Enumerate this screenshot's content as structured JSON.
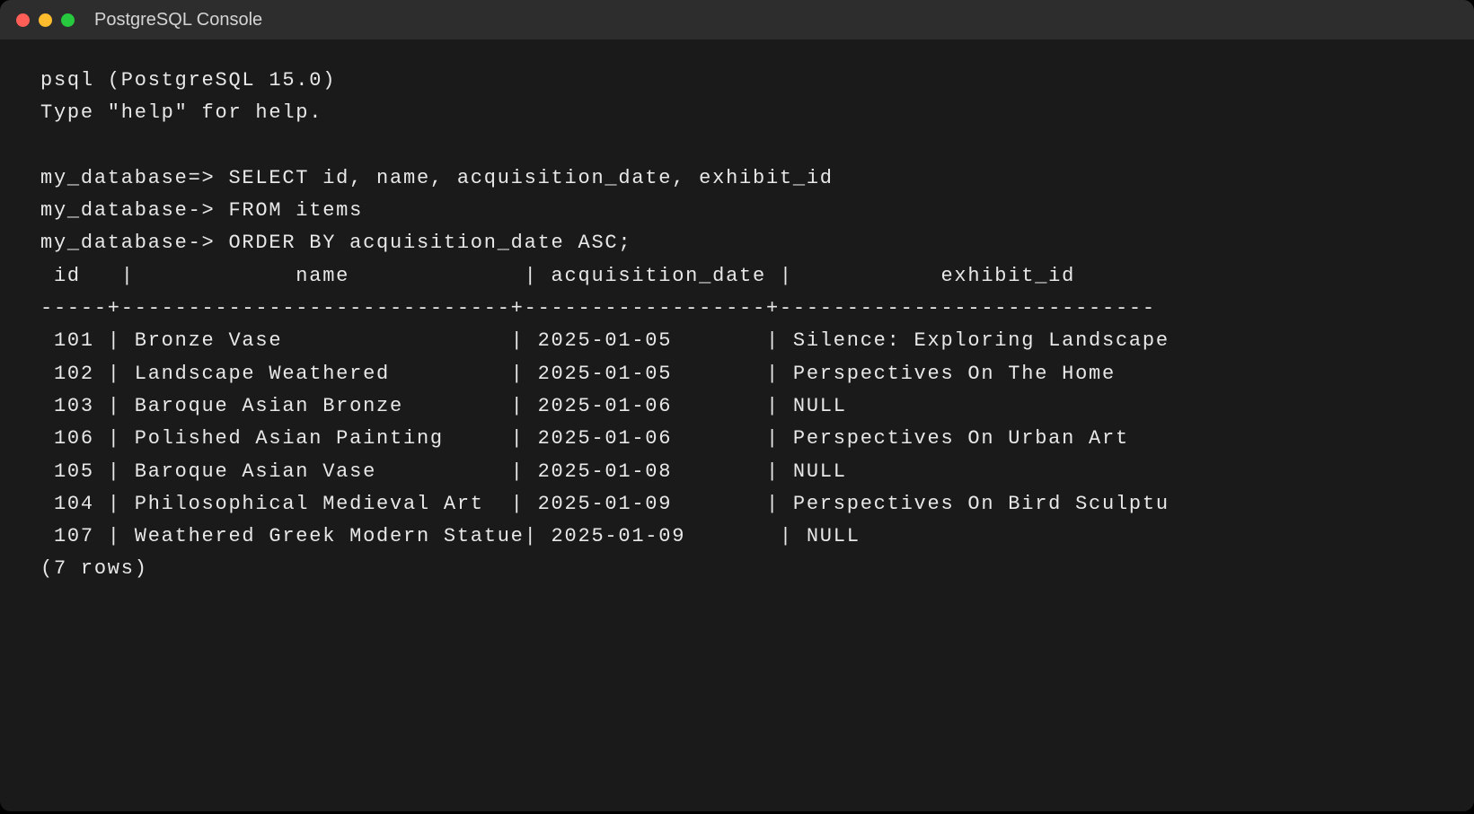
{
  "window": {
    "title": "PostgreSQL Console"
  },
  "terminal": {
    "header_line1": "psql (PostgreSQL 15.0)",
    "header_line2": "Type \"help\" for help.",
    "blank": "",
    "prompt_main": "my_database=>",
    "prompt_cont": "my_database->",
    "query_line1": "SELECT id, name, acquisition_date, exhibit_id",
    "query_line2": "FROM items",
    "query_line3": "ORDER BY acquisition_date ASC;",
    "columns": {
      "id": "id",
      "name": "name",
      "acquisition_date": "acquisition_date",
      "exhibit_id": "exhibit_id"
    },
    "separator": "-----+-----------------------------+------------------+----------------------------",
    "rows": [
      {
        "id": "101",
        "name": "Bronze Vase",
        "date": "2025-01-05",
        "exhibit": "Silence: Exploring Landscape"
      },
      {
        "id": "102",
        "name": "Landscape Weathered",
        "date": "2025-01-05",
        "exhibit": "Perspectives On The Home"
      },
      {
        "id": "103",
        "name": "Baroque Asian Bronze",
        "date": "2025-01-06",
        "exhibit": "NULL"
      },
      {
        "id": "106",
        "name": "Polished Asian Painting",
        "date": "2025-01-06",
        "exhibit": "Perspectives On Urban Art"
      },
      {
        "id": "105",
        "name": "Baroque Asian Vase",
        "date": "2025-01-08",
        "exhibit": "NULL"
      },
      {
        "id": "104",
        "name": "Philosophical Medieval Art",
        "date": "2025-01-09",
        "exhibit": "Perspectives On Bird Sculptu"
      },
      {
        "id": "107",
        "name": "Weathered Greek Modern Statue",
        "date": "2025-01-09",
        "exhibit": "NULL"
      }
    ],
    "row_count_text": "(7 rows)"
  }
}
